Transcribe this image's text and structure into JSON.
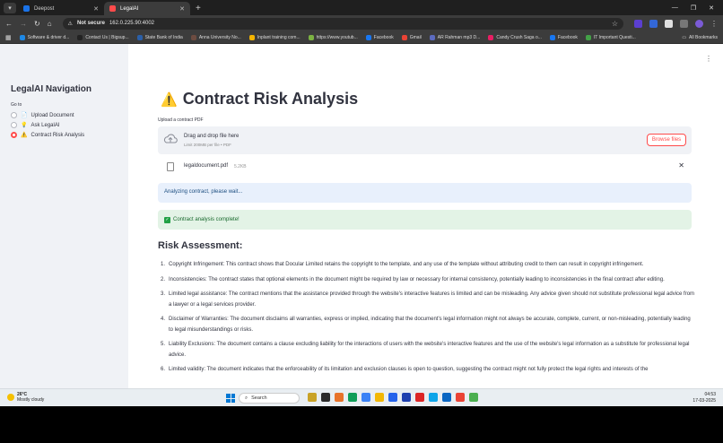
{
  "browser": {
    "tabs": [
      {
        "title": "Deepost",
        "active": false,
        "icon_color": "#1a73e8"
      },
      {
        "title": "LegalAI",
        "active": true,
        "icon_color": "#ff4b4b"
      }
    ],
    "security": "Not secure",
    "url": "162.0.225.90:4002",
    "bookmarks": [
      {
        "label": "Software & driver d...",
        "color": "#1e88e5"
      },
      {
        "label": "Contact Us | Bigsup...",
        "color": "#222222"
      },
      {
        "label": "State Bank of India",
        "color": "#2a5fa8"
      },
      {
        "label": "Anna University No...",
        "color": "#6d4c41"
      },
      {
        "label": "Inplant training com...",
        "color": "#f4b400"
      },
      {
        "label": "https://www.youtub...",
        "color": "#7cb342"
      },
      {
        "label": "Facebook",
        "color": "#1877f2"
      },
      {
        "label": "Gmail",
        "color": "#ea4335"
      },
      {
        "label": "AR Rahman mp3 D...",
        "color": "#5c6bc0"
      },
      {
        "label": "Candy Crush Saga o...",
        "color": "#e91e63"
      },
      {
        "label": "Facebook",
        "color": "#1877f2"
      },
      {
        "label": "IT Important Questi...",
        "color": "#43a047"
      }
    ],
    "all_bookmarks": "All Bookmarks"
  },
  "sidebar": {
    "title": "LegalAI Navigation",
    "goto_label": "Go to",
    "options": [
      {
        "label": "Upload Document",
        "emoji": "📄",
        "selected": false
      },
      {
        "label": "Ask LegalAI",
        "emoji": "💡",
        "selected": false
      },
      {
        "label": "Contract Risk Analysis",
        "emoji": "⚠️",
        "selected": true
      }
    ]
  },
  "main": {
    "title": "Contract Risk Analysis",
    "title_icon": "⚠️",
    "upload_label": "Upload a contract PDF",
    "dropzone_text": "Drag and drop file here",
    "dropzone_limit": "Limit 200MB per file • PDF",
    "browse_label": "Browse files",
    "file_name": "legaldocument.pdf",
    "file_size": "5.2KB",
    "info_msg": "Analyzing contract, please wait...",
    "success_msg": "Contract analysis complete!",
    "risk_heading": "Risk Assessment:",
    "risks": [
      "Copyright Infringement: This contract shows that Docular Limited retains the copyright to the template, and any use of the template without attributing credit to them can result in copyright infringement.",
      "Inconsistencies: The contract states that optional elements in the document might be required by law or necessary for internal consistency, potentially leading to inconsistencies in the final contract after editing.",
      "Limited legal assistance: The contract mentions that the assistance provided through the website's interactive features is limited and can be misleading. Any advice given should not substitute professional legal advice from a lawyer or a legal services provider.",
      "Disclaimer of Warranties: The document disclaims all warranties, express or implied, indicating that the document's legal information might not always be accurate, complete, current, or non-misleading, potentially leading to legal misunderstandings or risks.",
      "Liability Exclusions: The document contains a clause excluding liability for the interactions of users with the website's interactive features and the use of the website's legal information as a substitute for professional legal advice.",
      "Limited validity: The document indicates that the enforceability of its limitation and exclusion clauses is open to question, suggesting the contract might not fully protect the legal rights and interests of the"
    ]
  },
  "taskbar": {
    "temp": "26°C",
    "weather": "Mostly cloudy",
    "search_placeholder": "Search",
    "time": "04:53",
    "date": "17-03-2025",
    "app_colors": [
      "#c9a227",
      "#2b2b2b",
      "#e8732a",
      "#0f9d58",
      "#3b82f6",
      "#f2b705",
      "#2563eb",
      "#1e40af",
      "#dc2626",
      "#0ea5e9",
      "#0a66c2",
      "#ea4335",
      "#4caf50"
    ]
  }
}
